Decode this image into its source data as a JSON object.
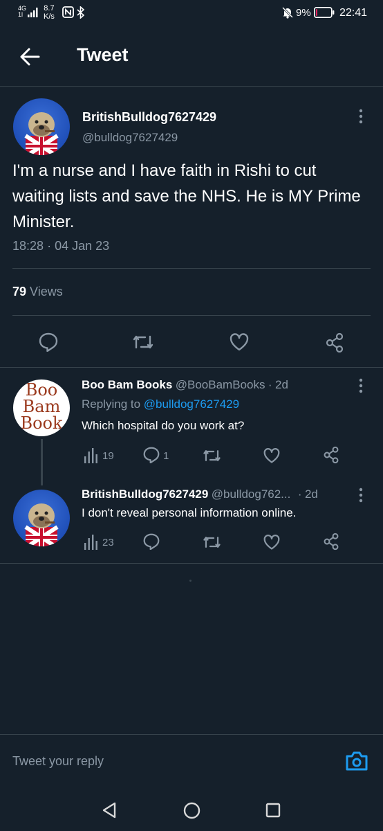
{
  "status_bar": {
    "network_top": "4G",
    "network_bottom": "1l",
    "speed_value": "8.7",
    "speed_unit": "K/s",
    "battery_percent": "9%",
    "time": "22:41",
    "battery_level": 0.09,
    "battery_color": "#e0245e"
  },
  "header": {
    "title": "Tweet"
  },
  "main_tweet": {
    "author_name": "BritishBulldog7627429",
    "author_handle": "@bulldog7627429",
    "text": "I'm a nurse and I have faith in Rishi to cut waiting lists and save the NHS. He is MY Prime Minister.",
    "time": "18:28",
    "separator": "·",
    "date": "04 Jan 23",
    "views_count": "79",
    "views_label": "Views"
  },
  "replies": [
    {
      "author_name": "Boo Bam Books",
      "author_handle": "@BooBamBooks",
      "separator": "·",
      "age": "2d",
      "replying_prefix": "Replying to",
      "replying_to": "@bulldog7627429",
      "text": "Which hospital do you work at?",
      "views": "19",
      "replies": "1",
      "avatar_lines": [
        "Boo",
        "Bam",
        "Book"
      ]
    },
    {
      "author_name": "BritishBulldog7627429",
      "author_handle": "@bulldog762...",
      "separator": "·",
      "age": "2d",
      "text": "I don't reveal personal information online.",
      "views": "23"
    }
  ],
  "composer": {
    "placeholder": "Tweet your reply"
  },
  "colors": {
    "background": "#15202b",
    "accent": "#1d9bf0",
    "muted": "#8b98a5",
    "divider": "#38444d"
  }
}
